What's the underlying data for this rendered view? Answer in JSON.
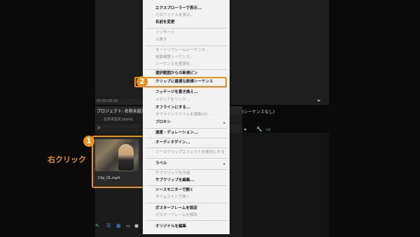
{
  "left_monitor": {
    "timecode": "00:00:00:00"
  },
  "project_panel": {
    "title": "プロジェクト: 名称未設定",
    "path": "名称未設定.prproj",
    "clip_name": "Clip_01.mp4"
  },
  "program_monitor": {
    "tab_label": "ム : (シーケンスなし)",
    "timecode": "00"
  },
  "callouts": {
    "badge_1": "1",
    "badge_2": "2",
    "right_click": "右クリック"
  },
  "context_menu": {
    "items": [
      {
        "label": "エクスプローラーで表示..."
      },
      {
        "label": "元のファイルを表示..."
      },
      {
        "label": "名前を変更"
      },
      {
        "label": "インサート"
      },
      {
        "label": "上書き"
      },
      {
        "label": "オートリフレームシーケンス..."
      },
      {
        "label": "自動補整シーケンス..."
      },
      {
        "label": "シーケンスを整頓化..."
      },
      {
        "label": "選択範囲からの新規ビン"
      },
      {
        "label": "クリップに最適な新規シーケンス"
      },
      {
        "label": "フッテージを置き換え..."
      },
      {
        "label": "メディアをリンク..."
      },
      {
        "label": "オフラインにする..."
      },
      {
        "label": "オフラインファイルを編集(O)..."
      },
      {
        "label": "プロキシ"
      },
      {
        "label": "速度・デュレーション..."
      },
      {
        "label": "オーディオゲイン..."
      },
      {
        "label": "ソースクリップエフェクトを無効にする"
      },
      {
        "label": "ラベル"
      },
      {
        "label": "サブクリップを作成"
      },
      {
        "label": "サブクリップを編集..."
      },
      {
        "label": "ソースモニターで開く"
      },
      {
        "label": "タイムラインで開く"
      },
      {
        "label": "ポスターフレームを設定"
      },
      {
        "label": "ポスターフレームを解除"
      },
      {
        "label": "オリジナルを編集"
      }
    ]
  },
  "colors": {
    "accent": "#e8911d",
    "menu_bg": "#f2f2f2",
    "panel_bg": "#1b1b1b"
  }
}
